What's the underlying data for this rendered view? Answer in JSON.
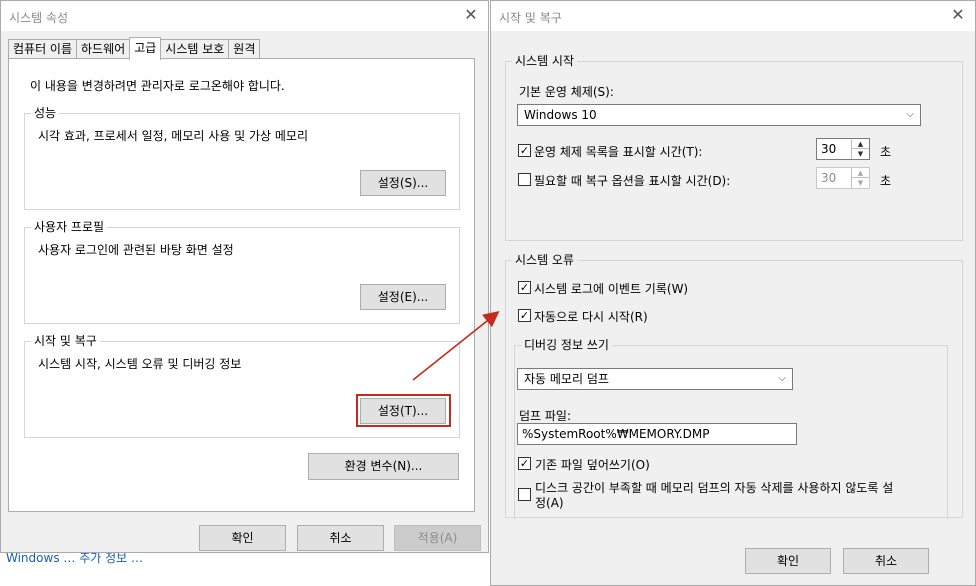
{
  "background_link": "Windows  … 추가 정보 …",
  "sysprops": {
    "title": "시스템 속성",
    "tabs": [
      "컴퓨터 이름",
      "하드웨어",
      "고급",
      "시스템 보호",
      "원격"
    ],
    "admin_note": "이 내용을 변경하려면 관리자로 로그온해야 합니다.",
    "performance": {
      "label": "성능",
      "desc": "시각 효과, 프로세서 일정, 메모리 사용 및 가상 메모리",
      "button": "설정(S)..."
    },
    "user_profiles": {
      "label": "사용자 프로필",
      "desc": "사용자 로그인에 관련된 바탕 화면 설정",
      "button": "설정(E)..."
    },
    "startup_recovery": {
      "label": "시작 및 복구",
      "desc": "시스템 시작, 시스템 오류 및 디버깅 정보",
      "button": "설정(T)..."
    },
    "env_button": "환경 변수(N)...",
    "ok": "확인",
    "cancel": "취소",
    "apply": "적용(A)"
  },
  "startup": {
    "title": "시작 및 복구",
    "system_start": {
      "label": "시스템 시작",
      "default_os_label": "기본 운영 체제(S):",
      "default_os_value": "Windows 10",
      "show_os_list_label": "운영 체제 목록을 표시할 시간(T):",
      "show_os_list_checked": true,
      "show_os_list_value": "30",
      "show_recovery_label": "필요할 때 복구 옵션을 표시할 시간(D):",
      "show_recovery_checked": false,
      "show_recovery_value": "30",
      "unit": "초"
    },
    "system_failure": {
      "label": "시스템 오류",
      "write_event_label": "시스템 로그에 이벤트 기록(W)",
      "write_event_checked": true,
      "auto_restart_label": "자동으로 다시 시작(R)",
      "auto_restart_checked": true
    },
    "debug": {
      "label": "디버깅 정보 쓰기",
      "dump_type": "자동 메모리 덤프",
      "dump_file_label": "덤프 파일:",
      "dump_file_value": "%SystemRoot%₩MEMORY.DMP",
      "overwrite_label": "기존 파일 덮어쓰기(O)",
      "overwrite_checked": true,
      "disable_auto_delete_line1": "디스크 공간이 부족할 때 메모리 덤프의 자동 삭제를 사용하지 않도록 설",
      "disable_auto_delete_line2": "정(A)",
      "disable_auto_delete_checked": false
    },
    "ok": "확인",
    "cancel": "취소"
  },
  "colors": {
    "highlight_box": "#c42b1c",
    "arrow": "#c42b1c"
  }
}
